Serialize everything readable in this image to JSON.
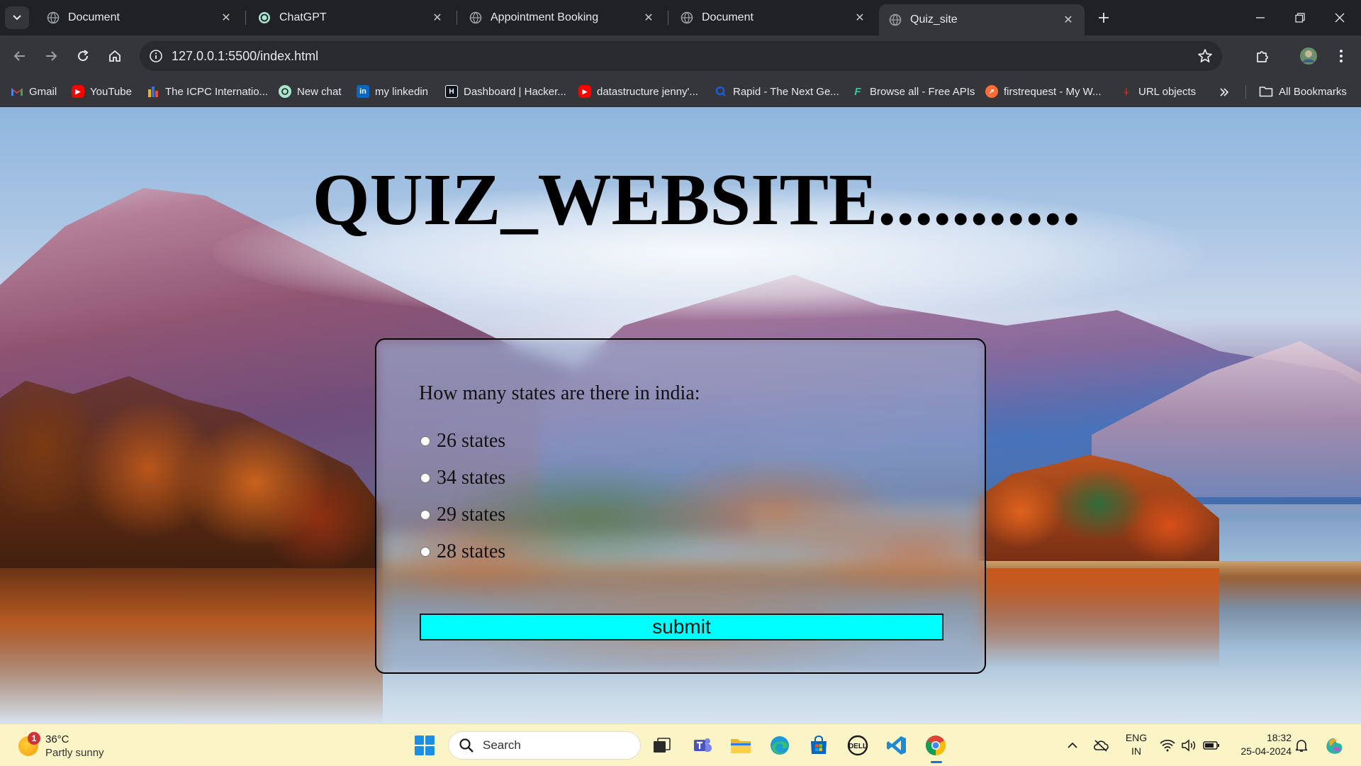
{
  "browser": {
    "tabs": [
      {
        "title": "Document",
        "active": false
      },
      {
        "title": "ChatGPT",
        "active": false
      },
      {
        "title": "Appointment Booking",
        "active": false
      },
      {
        "title": "Document",
        "active": false
      },
      {
        "title": "Quiz_site",
        "active": true
      }
    ],
    "url": "127.0.0.1:5500/index.html",
    "bookmarks": [
      {
        "label": "Gmail",
        "icon": "gmail-icon"
      },
      {
        "label": "YouTube",
        "icon": "youtube-icon"
      },
      {
        "label": "The ICPC Internatio...",
        "icon": "icpc-icon"
      },
      {
        "label": "New chat",
        "icon": "chatgpt-icon"
      },
      {
        "label": "my linkedin",
        "icon": "linkedin-icon"
      },
      {
        "label": "Dashboard | Hacker...",
        "icon": "hackerrank-icon"
      },
      {
        "label": "datastructure jenny'...",
        "icon": "youtube-icon"
      },
      {
        "label": "Rapid - The Next Ge...",
        "icon": "rapid-icon"
      },
      {
        "label": "Browse all - Free APIs",
        "icon": "freeapis-icon"
      },
      {
        "label": "firstrequest - My W...",
        "icon": "postman-icon"
      },
      {
        "label": "URL objects",
        "icon": "url-icon"
      }
    ],
    "all_bookmarks_label": "All Bookmarks"
  },
  "page": {
    "title": "QUIZ_WEBSITE...........",
    "question": "How many states are there in india:",
    "options": [
      "26 states",
      "34 states",
      "29 states",
      "28 states"
    ],
    "submit_label": "submit"
  },
  "taskbar": {
    "weather": {
      "temp": "36°C",
      "condition": "Partly sunny",
      "badge": "1"
    },
    "search_placeholder": "Search",
    "language": {
      "line1": "ENG",
      "line2": "IN"
    },
    "time": "18:32",
    "date": "25-04-2024"
  },
  "colors": {
    "submit_bg": "#00ffff",
    "chrome_dark": "#202124",
    "taskbar_bg": "#fbf4c6"
  }
}
